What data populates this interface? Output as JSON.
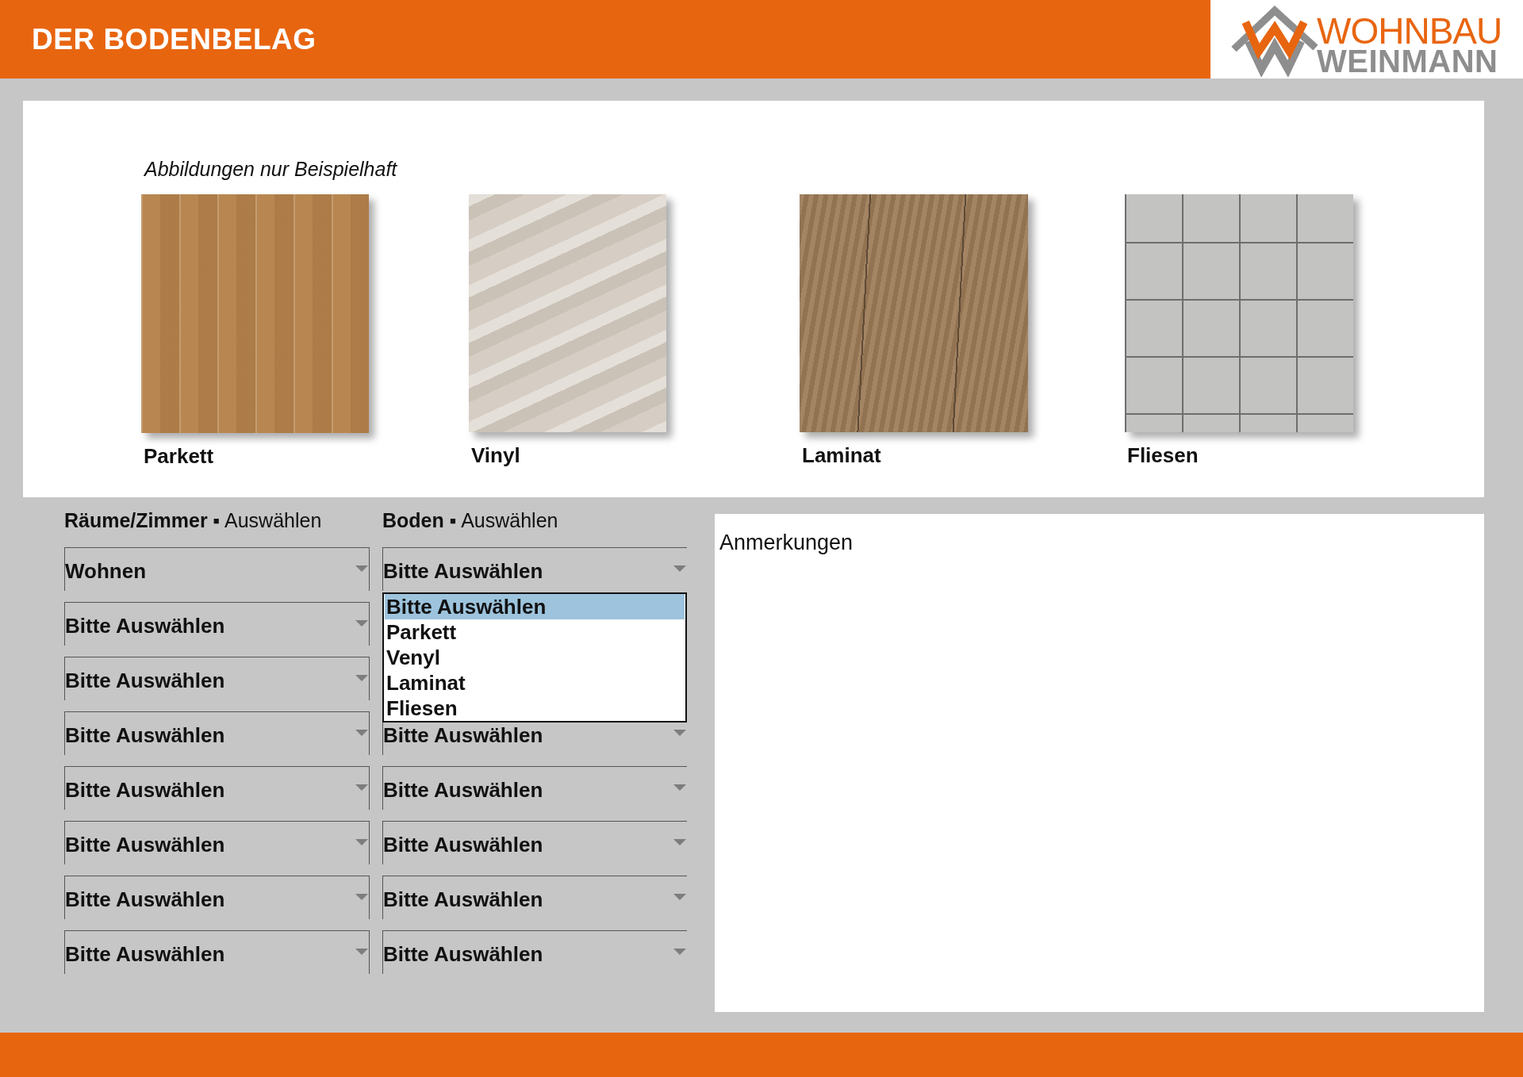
{
  "header": {
    "title": "DER BODENBELAG",
    "logo": {
      "line_1": "WOHNBAU",
      "line_2": "WEINMANN"
    }
  },
  "gallery": {
    "caption": "Abbildungen nur Beispielhaft",
    "items": [
      {
        "label": "Parkett"
      },
      {
        "label": "Vinyl"
      },
      {
        "label": "Laminat"
      },
      {
        "label": "Fliesen"
      }
    ]
  },
  "selection": {
    "columns": [
      {
        "heading": "**Räume/Zimmer** ▪ Auswählen"
      },
      {
        "heading": "**Boden** ▪ Auswählen"
      }
    ],
    "rows": [
      {
        "room": {
          "value": "Wohnen"
        },
        "floor": {
          "value": "Bitte Auswählen",
          "menu": {
            "options": [
              {
                "label": "Bitte Auswählen",
                "selected": true
              },
              {
                "label": "Parkett",
                "selected": false
              },
              {
                "label": "Venyl",
                "selected": false
              },
              {
                "label": "Laminat",
                "selected": false
              },
              {
                "label": "Fliesen",
                "selected": false
              }
            ]
          }
        }
      },
      {
        "room": {
          "value": "Bitte Auswählen"
        }
      },
      {
        "room": {
          "value": "Bitte Auswählen"
        }
      },
      {
        "room": {
          "value": "Bitte Auswählen"
        },
        "floor": {
          "value": "Bitte Auswählen"
        }
      },
      {
        "room": {
          "value": "Bitte Auswählen"
        },
        "floor": {
          "value": "Bitte Auswählen"
        }
      },
      {
        "room": {
          "value": "Bitte Auswählen"
        },
        "floor": {
          "value": "Bitte Auswählen"
        }
      },
      {
        "room": {
          "value": "Bitte Auswählen"
        },
        "floor": {
          "value": "Bitte Auswählen"
        }
      },
      {
        "room": {
          "value": "Bitte Auswählen"
        },
        "floor": {
          "value": "Bitte Auswählen"
        }
      }
    ]
  },
  "notes": {
    "label": "Anmerkungen"
  }
}
